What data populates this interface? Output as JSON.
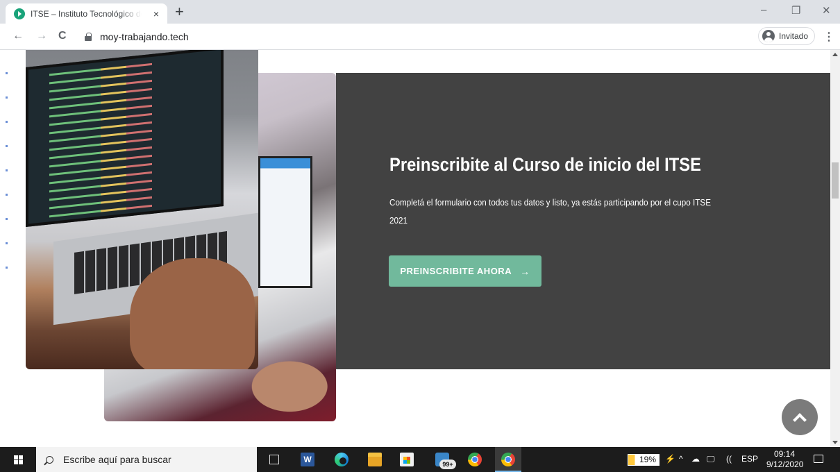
{
  "browser": {
    "tab_title": "ITSE – Instituto Tecnológico de Santiago del Estero",
    "tab_close": "×",
    "new_tab": "+",
    "window_controls": {
      "minimize": "–",
      "restore": "❐",
      "close": "✕"
    },
    "nav": {
      "back": "←",
      "forward": "→",
      "reload": "C"
    },
    "url": "moy-trabajando.tech",
    "profile_label": "Invitado",
    "menu": "⋮"
  },
  "page": {
    "headline": "Preinscribite al Curso de inicio del ITSE",
    "body": "Completá el formulario con todos tus datos y listo,  ya estás participando por el cupo ITSE 2021",
    "cta_label": "PREINSCRIBITE AHORA",
    "cta_icon": "→",
    "colors": {
      "panel": "#424242",
      "accent": "#71b99c",
      "scroll_top": "#7b7b7b"
    }
  },
  "taskbar": {
    "search_placeholder": "Escribe aquí para buscar",
    "word_letter": "W",
    "mail_badge": "99+",
    "battery": "19%",
    "tray": {
      "plug": "⚡",
      "chevron": "^",
      "cloud": "☁",
      "network": "🖵",
      "wifi": "((",
      "language": "ESP"
    },
    "time": "09:14",
    "date": "9/12/2020"
  }
}
